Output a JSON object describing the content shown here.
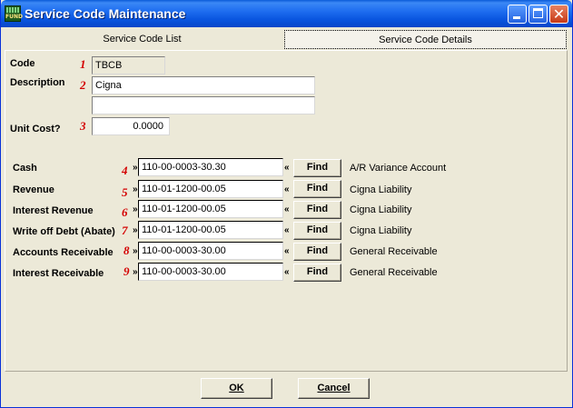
{
  "window": {
    "title": "Service Code Maintenance",
    "icon_text": "FUND"
  },
  "tabs": [
    {
      "label": "Service Code List"
    },
    {
      "label": "Service Code Details"
    }
  ],
  "form": {
    "code": {
      "label": "Code",
      "marker": "1",
      "value": "TBCB"
    },
    "description": {
      "label": "Description",
      "marker": "2",
      "line1": "Cigna",
      "line2": ""
    },
    "unit_cost": {
      "label": "Unit Cost?",
      "marker": "3",
      "value": "0.0000"
    }
  },
  "accounts": [
    {
      "label": "Cash",
      "marker": "4",
      "value": "110-00-0003-30.30",
      "find": "Find",
      "desc": "A/R Variance Account"
    },
    {
      "label": "Revenue",
      "marker": "5",
      "value": "110-01-1200-00.05",
      "find": "Find",
      "desc": "Cigna Liability"
    },
    {
      "label": "Interest Revenue",
      "marker": "6",
      "value": "110-01-1200-00.05",
      "find": "Find",
      "desc": "Cigna Liability"
    },
    {
      "label": "Write off Debt (Abate)",
      "marker": "7",
      "value": "110-01-1200-00.05",
      "find": "Find",
      "desc": "Cigna Liability"
    },
    {
      "label": "Accounts Receivable",
      "marker": "8",
      "value": "110-00-0003-30.00",
      "find": "Find",
      "desc": "General Receivable"
    },
    {
      "label": "Interest Receivable",
      "marker": "9",
      "value": "110-00-0003-30.00",
      "find": "Find",
      "desc": "General Receivable"
    }
  ],
  "arrows": {
    "left": "»",
    "right": "«"
  },
  "buttons": {
    "ok": "OK",
    "cancel": "Cancel"
  }
}
